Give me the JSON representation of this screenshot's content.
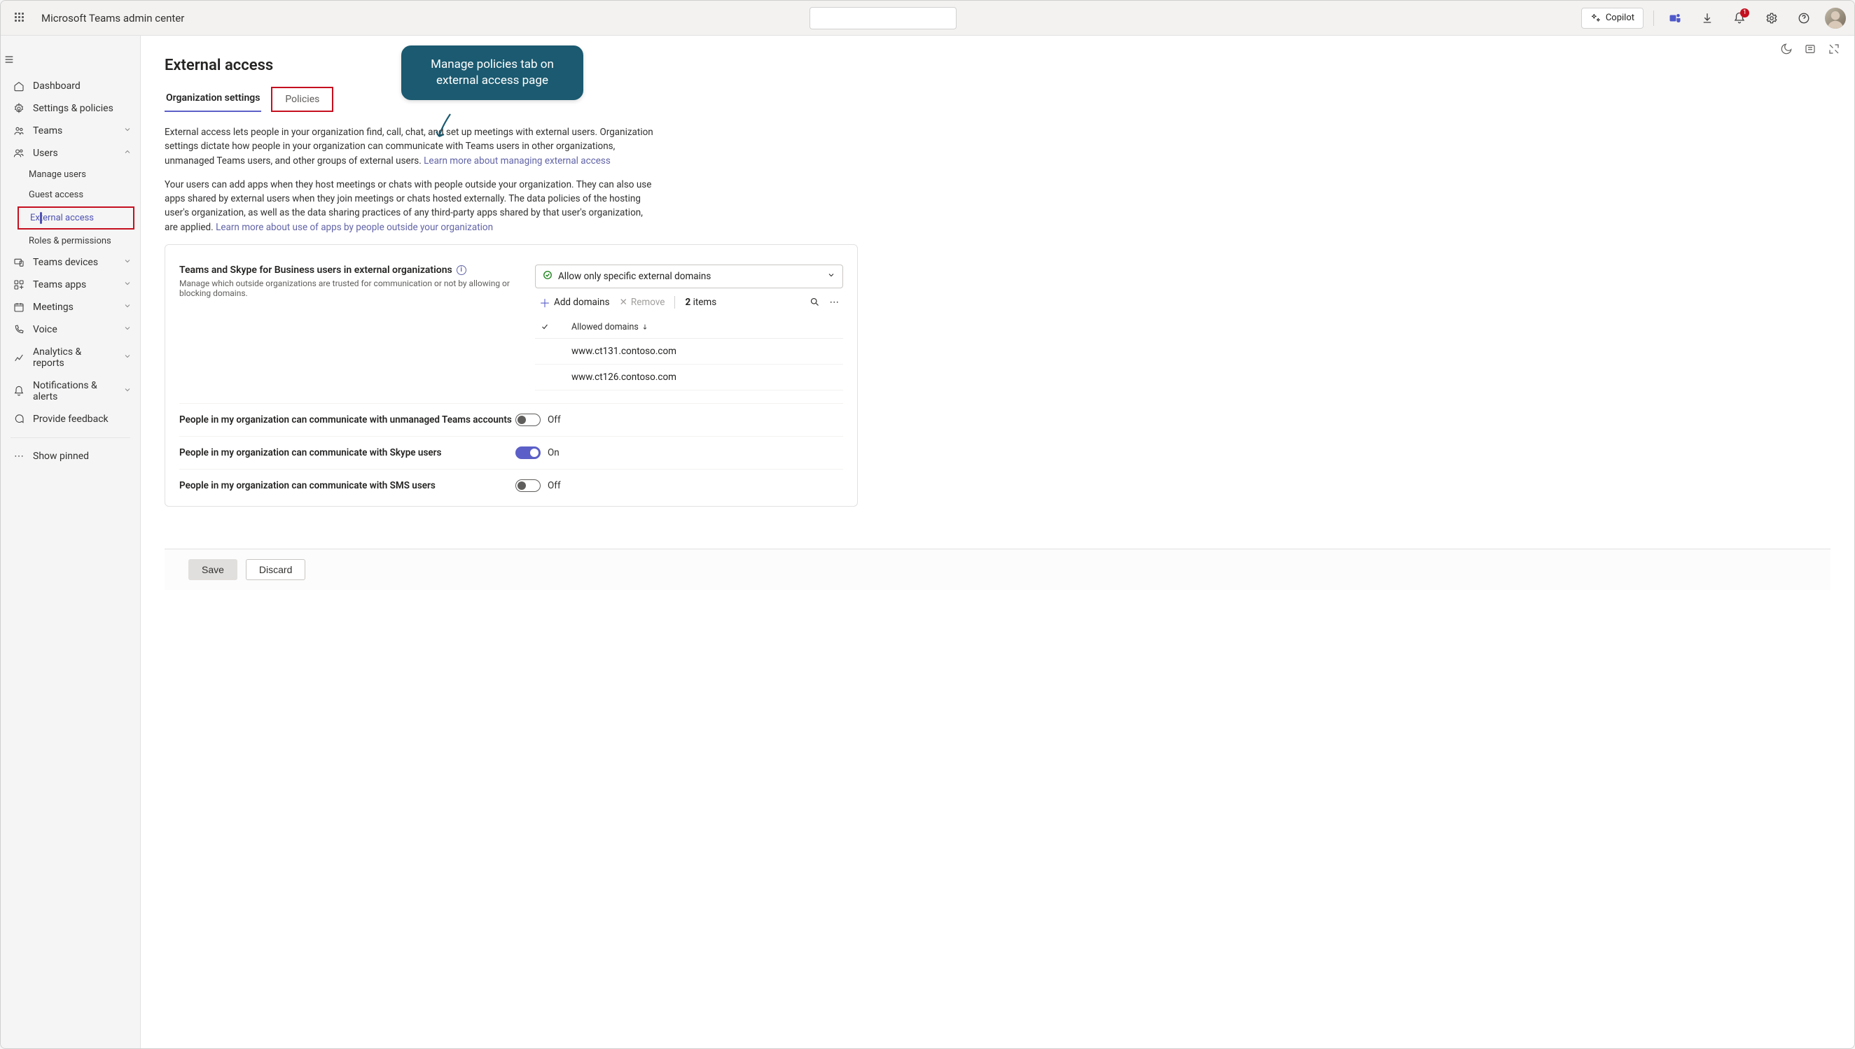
{
  "header": {
    "app_title": "Microsoft Teams admin center",
    "copilot_label": "Copilot",
    "notification_count": "1"
  },
  "sidebar": {
    "items": [
      {
        "label": "Dashboard",
        "icon": "home"
      },
      {
        "label": "Settings & policies",
        "icon": "gear"
      },
      {
        "label": "Teams",
        "icon": "people",
        "expandable": true,
        "expanded": false
      },
      {
        "label": "Users",
        "icon": "user",
        "expandable": true,
        "expanded": true,
        "children": [
          {
            "label": "Manage users"
          },
          {
            "label": "Guest access"
          },
          {
            "label": "External access",
            "active": true
          },
          {
            "label": "Roles & permissions"
          }
        ]
      },
      {
        "label": "Teams devices",
        "icon": "device",
        "expandable": true
      },
      {
        "label": "Teams apps",
        "icon": "apps",
        "expandable": true
      },
      {
        "label": "Meetings",
        "icon": "calendar",
        "expandable": true
      },
      {
        "label": "Voice",
        "icon": "phone",
        "expandable": true
      },
      {
        "label": "Analytics & reports",
        "icon": "chart",
        "expandable": true
      },
      {
        "label": "Notifications & alerts",
        "icon": "bell",
        "expandable": true
      },
      {
        "label": "Provide feedback",
        "icon": "feedback"
      }
    ],
    "show_pinned": "Show pinned"
  },
  "page": {
    "title": "External access",
    "tabs": [
      {
        "label": "Organization settings",
        "active": true
      },
      {
        "label": "Policies",
        "active": false
      }
    ],
    "desc1_a": "External access lets people in your organization find, call, chat, and set up meetings with external users. Organization settings dictate how people in your organization can communicate with Teams users in other organizations, unmanaged Teams users, and other groups of external users. ",
    "desc1_link": "Learn more about managing external access",
    "desc2_a": "Your users can add apps when they host meetings or chats with people outside your organization. They can also use apps shared by external users when they join meetings or chats hosted externally. The data policies of the hosting user's organization, as well as the data sharing practices of any third-party apps shared by that user's organization, are applied. ",
    "desc2_link": "Learn more about use of apps by people outside your organization",
    "teams_skype_section": {
      "title": "Teams and Skype for Business users in external organizations",
      "subtitle": "Manage which outside organizations are trusted for communication or not by allowing or blocking domains.",
      "dropdown_value": "Allow only specific external domains",
      "toolbar": {
        "add": "Add domains",
        "remove": "Remove",
        "count_num": "2",
        "count_label": "items"
      },
      "col_header": "Allowed domains",
      "domains": [
        "www.ct131.contoso.com",
        "www.ct126.contoso.com"
      ]
    },
    "toggles": [
      {
        "label": "People in my organization can communicate with unmanaged Teams accounts",
        "on": false,
        "text": "Off"
      },
      {
        "label": "People in my organization can communicate with Skype users",
        "on": true,
        "text": "On"
      },
      {
        "label": "People in my organization can communicate with SMS users",
        "on": false,
        "text": "Off"
      }
    ],
    "footer": {
      "save": "Save",
      "discard": "Discard"
    }
  },
  "callout": {
    "line1": "Manage policies tab on",
    "line2": "external access page"
  }
}
